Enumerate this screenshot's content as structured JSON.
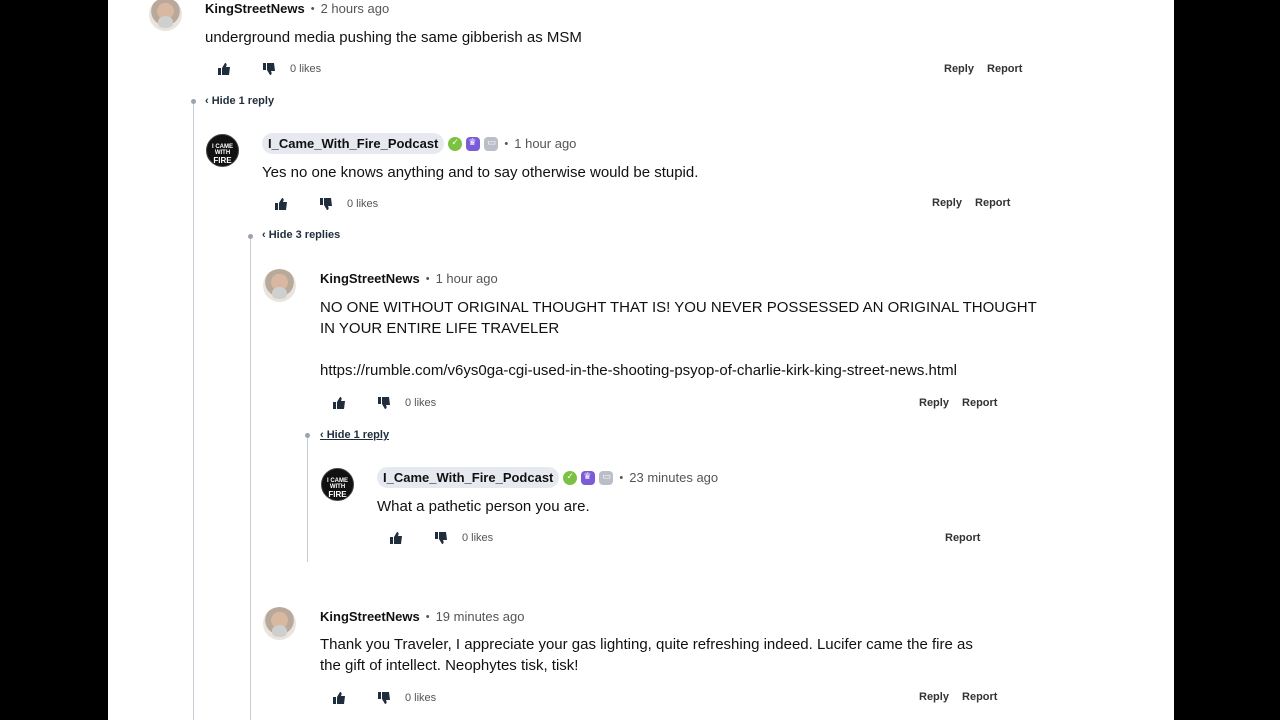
{
  "comments": [
    {
      "user": "KingStreetNews",
      "time": "2 hours ago",
      "text": "underground media pushing the same gibberish as MSM",
      "likes": "0 likes",
      "reply": "Reply",
      "report": "Report",
      "toggle": "‹ Hide 1 reply"
    },
    {
      "user": "I_Came_With_Fire_Podcast",
      "time": "1 hour ago",
      "text": "Yes no one knows anything and to say otherwise would be stupid.",
      "likes": "0 likes",
      "reply": "Reply",
      "report": "Report",
      "toggle": "‹ Hide 3 replies"
    },
    {
      "user": "KingStreetNews",
      "time": "1 hour ago",
      "text_line1": "NO ONE WITHOUT ORIGINAL THOUGHT THAT IS! YOU NEVER POSSESSED AN ORIGINAL THOUGHT",
      "text_line2": "IN YOUR ENTIRE LIFE TRAVELER",
      "link": "https://rumble.com/v6ys0ga-cgi-used-in-the-shooting-psyop-of-charlie-kirk-king-street-news.html",
      "likes": "0 likes",
      "reply": "Reply",
      "report": "Report",
      "toggle": "‹ Hide 1 reply"
    },
    {
      "user": "I_Came_With_Fire_Podcast",
      "time": "23 minutes ago",
      "text": "What a pathetic person you are.",
      "likes": "0 likes",
      "report": "Report"
    },
    {
      "user": "KingStreetNews",
      "time": "19 minutes ago",
      "text_line1": "Thank you Traveler, I appreciate your gas lighting, quite refreshing indeed. Lucifer came the fire as",
      "text_line2": "the gift of intellect. Neophytes tisk, tisk!",
      "likes": "0 likes",
      "reply": "Reply",
      "report": "Report"
    }
  ],
  "avatar_fire": {
    "line1": "I CAME WITH",
    "line2": "FIRE"
  },
  "icons": [
    "thumbs-up-icon",
    "thumbs-down-icon",
    "verified-badge-icon",
    "premium-crown-icon",
    "media-badge-icon"
  ],
  "colors": {
    "background": "#000000",
    "page": "#ffffff",
    "thread_line": "#c7cdd6",
    "pill": "#e6e9ef"
  }
}
